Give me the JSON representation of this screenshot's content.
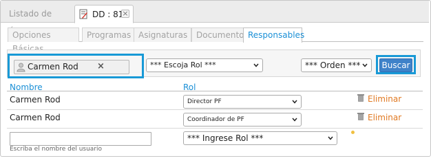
{
  "window": {
    "tabs": [
      {
        "label": "Listado de Áreas",
        "active": false
      },
      {
        "label": "DD : 81",
        "active": true,
        "close": "×"
      }
    ]
  },
  "subtabs": [
    {
      "label": "Opciones Básicas"
    },
    {
      "label": "Programas"
    },
    {
      "label": "Asignaturas"
    },
    {
      "label": "Documentos"
    },
    {
      "label": "Responsables",
      "active": true
    }
  ],
  "filters": {
    "user": "Carmen Rod",
    "user_clear": "×",
    "role_select": "*** Escoja Rol ***",
    "order_select": "*** Orden ***",
    "search_button": "Buscar"
  },
  "table": {
    "headers": [
      "Nombre",
      "Rol"
    ],
    "rows": [
      {
        "name": "Carmen Rod",
        "role": "Director PF",
        "action": "Eliminar"
      },
      {
        "name": "Carmen Rod",
        "role": "Coordinador de PF",
        "action": "Eliminar"
      }
    ],
    "new_row": {
      "name_value": "",
      "name_hint": "Escriba el nombre del usuario",
      "role_select": "*** Ingrese Rol ***"
    }
  },
  "colors": {
    "accent": "#1a8fd6",
    "highlight": "#1899d6",
    "button": "#3f82c9",
    "delete": "#e07820"
  },
  "icons": [
    "document-icon",
    "user-icon",
    "chevron-down-icon",
    "trash-icon",
    "star-icon"
  ]
}
